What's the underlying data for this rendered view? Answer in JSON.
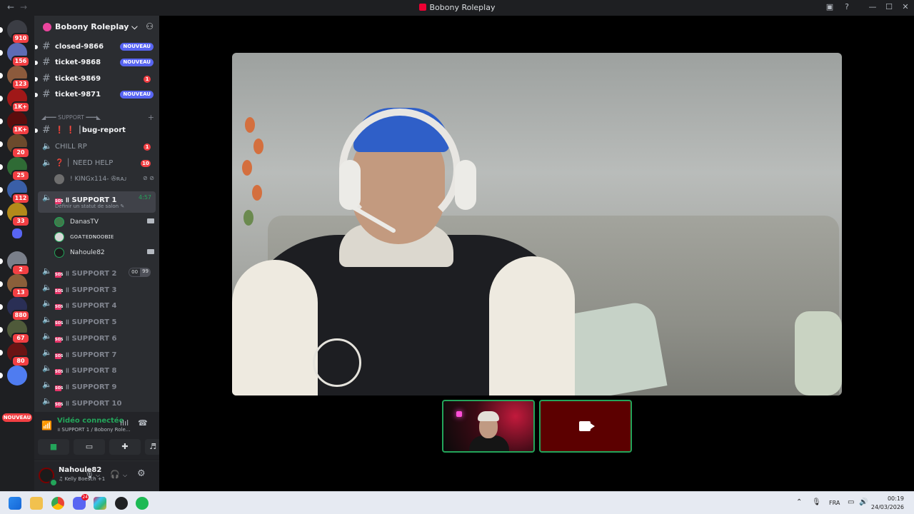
{
  "window": {
    "title": "Bobony Roleplay",
    "back_icon": "←",
    "forward_icon": "→"
  },
  "rail": {
    "servers": [
      {
        "badge": "910",
        "color": "#3b3d44"
      },
      {
        "badge": "156",
        "color": "#5d6cb5",
        "sound": true
      },
      {
        "badge": "123",
        "color": "#8c5a3c"
      },
      {
        "badge": "1K+",
        "color": "#a01818"
      },
      {
        "badge": "1K+",
        "color": "#5a0d0d"
      },
      {
        "badge": "20",
        "color": "#6b4a2c"
      },
      {
        "badge": "25",
        "color": "#2f6b35"
      },
      {
        "badge": "112",
        "color": "#3a5fa8"
      },
      {
        "badge": "33",
        "color": "#b38a1a"
      },
      {
        "badge": "",
        "color": "#5865f2"
      },
      {
        "badge": "2",
        "color": "#7a7f8a"
      },
      {
        "badge": "13",
        "color": "#8a5f3a"
      },
      {
        "badge": "880",
        "color": "#2a2f55"
      },
      {
        "badge": "67",
        "color": "#4f5a3a"
      },
      {
        "badge": "80",
        "color": "#6a1414"
      },
      {
        "badge": "",
        "color": "#4f7cf0"
      }
    ],
    "nouveau_label": "NOUVEAU"
  },
  "sidebar": {
    "guild_name": "Bobony Roleplay",
    "chevron": "⌵",
    "channels_top": [
      {
        "name": "closed-9866",
        "badge_type": "new",
        "badge": "NOUVEAU"
      },
      {
        "name": "ticket-9868",
        "badge_type": "new",
        "badge": "NOUVEAU"
      },
      {
        "name": "ticket-9869",
        "badge_type": "count",
        "badge": "1"
      },
      {
        "name": "ticket-9871",
        "badge_type": "new",
        "badge": "NOUVEAU"
      }
    ],
    "category": "◢━━━ SUPPORT ━━━◣",
    "bug_report": "❗ ❗ │bug-report",
    "chill_rp": {
      "name": "CHILL RP",
      "badge": "1"
    },
    "need_help": {
      "name": "❓ │ NEED HELP",
      "badge": "10"
    },
    "need_help_user": "! KINGx114- ✇ʀᴀᴊ",
    "support1": {
      "name": "॥ SUPPORT 1",
      "timer": "4:57",
      "status": "Définir un statut de salon ✎",
      "users": [
        {
          "name": "DanasTV",
          "cam": true,
          "color": "#3f7a4a"
        },
        {
          "name": "ɢᴏᴀᴛᴇᴅɴᴏᴏʙɪᴇ",
          "cam": false,
          "color": "#d8d8d8"
        },
        {
          "name": "Nahoule82",
          "cam": true,
          "color": "#1b1b1b"
        }
      ]
    },
    "support_rooms": [
      {
        "name": "॥ SUPPORT 2",
        "limit_a": "00",
        "limit_b": "99"
      },
      {
        "name": "॥ SUPPORT 3"
      },
      {
        "name": "॥ SUPPORT 4"
      },
      {
        "name": "॥ SUPPORT 5"
      },
      {
        "name": "॥ SUPPORT 6"
      },
      {
        "name": "॥ SUPPORT 7"
      },
      {
        "name": "॥ SUPPORT 8"
      },
      {
        "name": "॥ SUPPORT 9"
      },
      {
        "name": "॥ SUPPORT 10"
      }
    ],
    "sos_label": "SOS"
  },
  "voice": {
    "state": "Vidéo connectée",
    "location": "॥ SUPPORT 1 / Bobony Role..."
  },
  "user": {
    "name": "Nahoule82",
    "status": "♫ Kelly Boesch +1"
  },
  "taskbar": {
    "discord_badge": "24",
    "lang": "FRA",
    "time": "00:19",
    "date": "24/03/2026"
  }
}
